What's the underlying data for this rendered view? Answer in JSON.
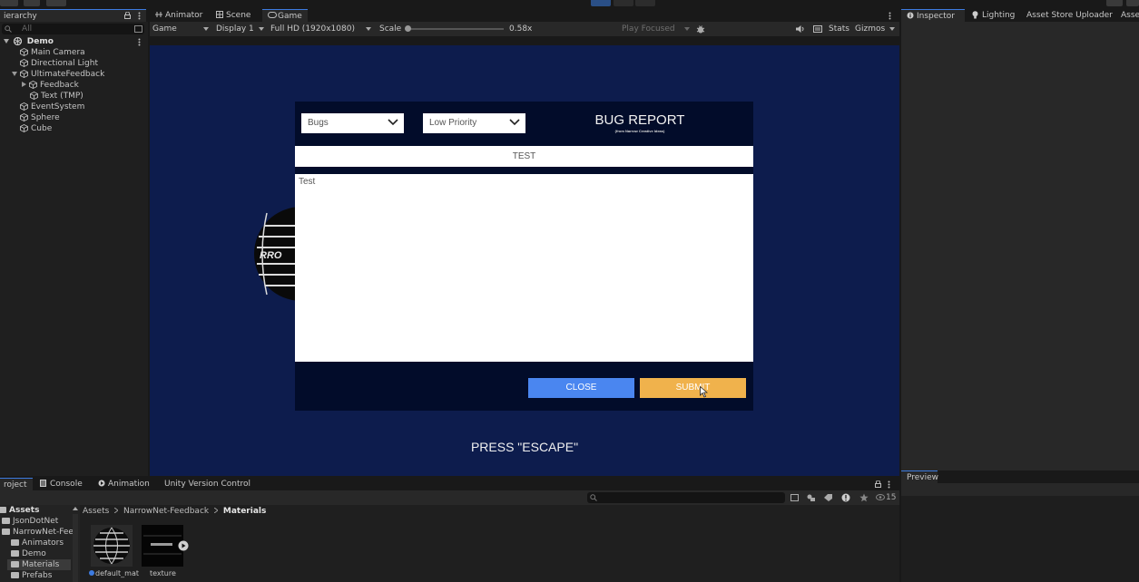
{
  "hierarchy": {
    "tab_label": "ierarchy",
    "search_placeholder": "All",
    "items": [
      {
        "label": "Demo",
        "depth": 0
      },
      {
        "label": "Main Camera",
        "depth": 1
      },
      {
        "label": "Directional Light",
        "depth": 1
      },
      {
        "label": "UltimateFeedback",
        "depth": 1
      },
      {
        "label": "Feedback",
        "depth": 2
      },
      {
        "label": "Text (TMP)",
        "depth": 2
      },
      {
        "label": "EventSystem",
        "depth": 1
      },
      {
        "label": "Sphere",
        "depth": 1
      },
      {
        "label": "Cube",
        "depth": 1
      }
    ]
  },
  "game_view": {
    "tabs": [
      {
        "label": "Animator"
      },
      {
        "label": "Scene"
      },
      {
        "label": "Game"
      }
    ],
    "toolbar": {
      "mode": "Game",
      "display": "Display 1",
      "resolution": "Full HD (1920x1080)",
      "scale_label": "Scale",
      "scale_value": "0.58x",
      "play_focused": "Play Focused",
      "stats": "Stats",
      "gizmos": "Gizmos"
    },
    "scale_level": 0.02,
    "sphere_text": "RRO"
  },
  "feedback_form": {
    "category": "Bugs",
    "priority": "Low Priority",
    "title": "BUG REPORT",
    "subtitle": "(from Narrow Creative Ideas)",
    "subject": "TEST",
    "body": "Test",
    "close_label": "CLOSE",
    "submit_label": "SUBMIT",
    "close_color": "#4a86f0",
    "submit_color": "#f0b24c"
  },
  "press_escape": "PRESS \"ESCAPE\"",
  "inspector": {
    "tabs": [
      {
        "label": "Inspector"
      },
      {
        "label": "Lighting"
      },
      {
        "label": "Asset Store Uploader"
      },
      {
        "label": "Asse"
      }
    ],
    "preview_label": "Preview"
  },
  "project": {
    "tabs": [
      {
        "label": "roject"
      },
      {
        "label": "Console"
      },
      {
        "label": "Animation"
      },
      {
        "label": "Unity Version Control"
      }
    ],
    "hidden_count": "15",
    "tree": [
      {
        "label": "Assets",
        "depth": 0
      },
      {
        "label": "JsonDotNet",
        "depth": 1
      },
      {
        "label": "NarrowNet-Fee",
        "depth": 1
      },
      {
        "label": "Animators",
        "depth": 2
      },
      {
        "label": "Demo",
        "depth": 2
      },
      {
        "label": "Materials",
        "depth": 2
      },
      {
        "label": "Prefabs",
        "depth": 2
      }
    ],
    "breadcrumb": [
      "Assets",
      "NarrowNet-Feedback",
      "Materials"
    ],
    "assets": [
      {
        "label": "default_mat"
      },
      {
        "label": "texture"
      }
    ]
  },
  "colors": {
    "game_bg": "#0d1c4d",
    "modal_bg": "#020c2a",
    "accent_blue": "#3d7be0"
  }
}
